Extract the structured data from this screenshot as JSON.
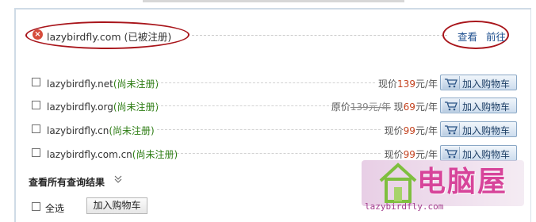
{
  "primary": {
    "domain_text": "lazybirdfly.com (已被注册)",
    "view_link": "查看",
    "go_link": "前往",
    "status_icon": "error-x-icon",
    "annotation_color": "#a8141a"
  },
  "domains": [
    {
      "name": "lazybirdfly.net",
      "status": "(尚未注册)",
      "price_prefix": "现价",
      "price_value": "139",
      "price_suffix": "元/年",
      "cart_label": "加入购物车"
    },
    {
      "name": "lazybirdfly.org",
      "status": "(尚未注册)",
      "orig_prefix": "原价",
      "orig_value": "139元/年",
      "price_prefix": "现",
      "price_value": "69",
      "price_suffix": "元/年",
      "cart_label": "加入购物车"
    },
    {
      "name": "lazybirdfly.cn",
      "status": "(尚未注册)",
      "price_prefix": "现价",
      "price_value": "99",
      "price_suffix": "元/年",
      "cart_label": "加入购物车"
    },
    {
      "name": "lazybirdfly.com.cn",
      "status": "(尚未注册)",
      "price_prefix": "现价",
      "price_value": "99",
      "price_suffix": "元/年",
      "cart_label": "加入购物车"
    }
  ],
  "view_all": "查看所有查询结果",
  "view_all_icon": "chevron-down-icon",
  "select_all": "全选",
  "bulk_cart": "加入购物车",
  "watermark": {
    "title": "电脑屋",
    "url": "lazybirdfly.com"
  },
  "colors": {
    "status_green": "#2e7d14",
    "price_red": "#c3401c",
    "link_blue": "#1e4f8f"
  }
}
